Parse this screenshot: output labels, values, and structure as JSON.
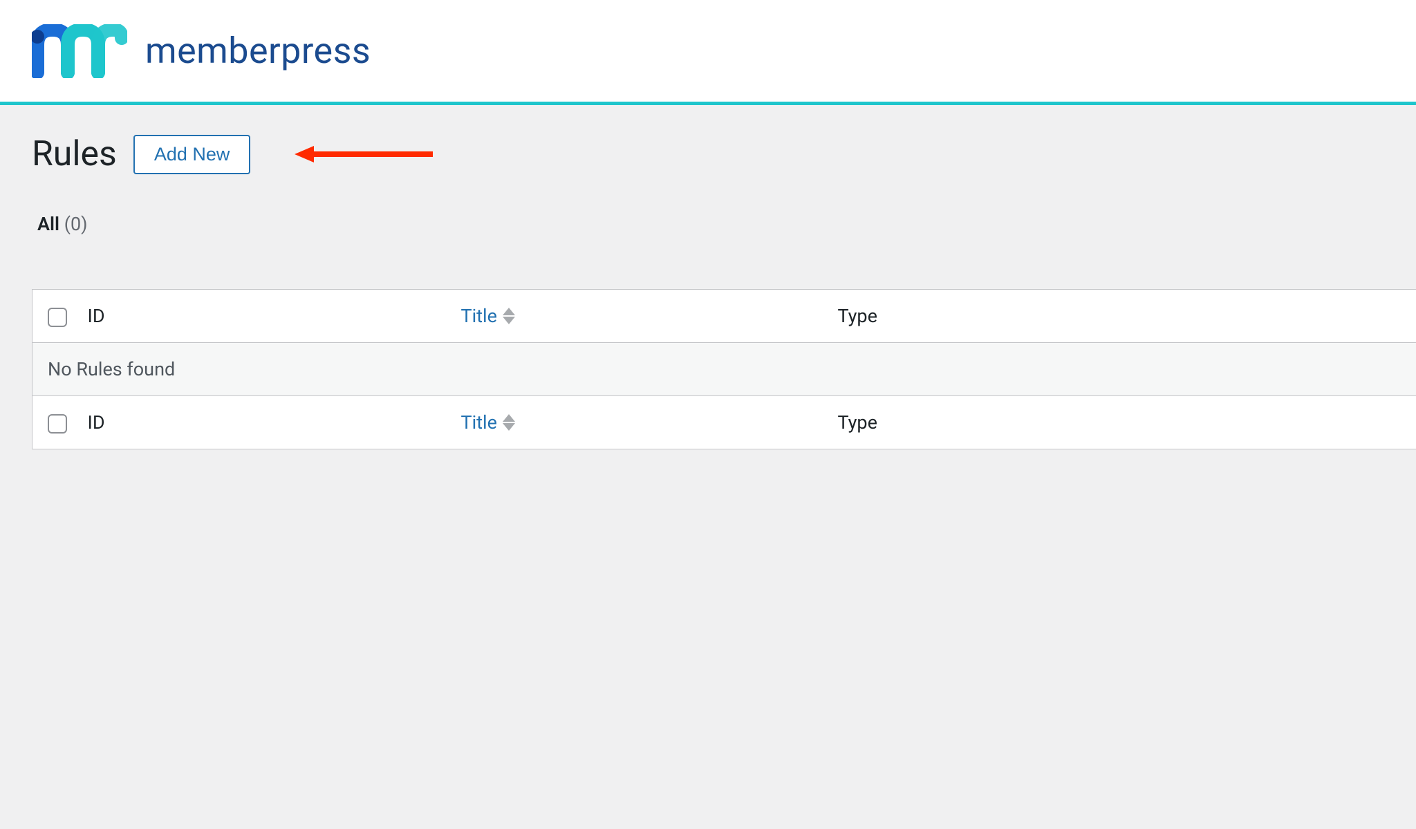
{
  "brand": {
    "name": "memberpress"
  },
  "page": {
    "title": "Rules",
    "addNewLabel": "Add New"
  },
  "filters": {
    "allLabel": "All",
    "allCount": "(0)"
  },
  "table": {
    "columns": {
      "id": "ID",
      "title": "Title",
      "type": "Type"
    },
    "emptyMessage": "No Rules found"
  }
}
